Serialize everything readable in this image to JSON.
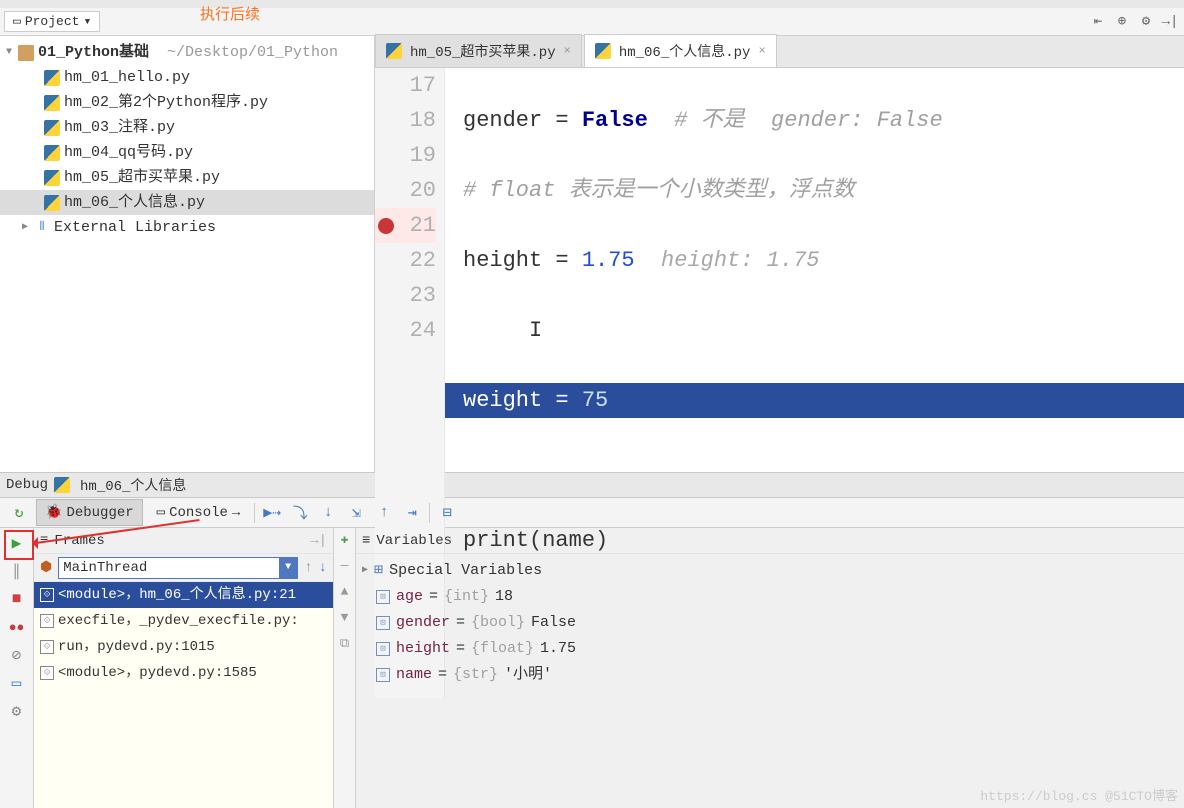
{
  "breadcrumb": {
    "a": "01_Python基础",
    "b": "hm_06_个人信息.py"
  },
  "project_dropdown": "Project",
  "tree": {
    "root": "01_Python基础",
    "root_path": "~/Desktop/01_Python",
    "files": [
      "hm_01_hello.py",
      "hm_02_第2个Python程序.py",
      "hm_03_注释.py",
      "hm_04_qq号码.py",
      "hm_05_超市买苹果.py",
      "hm_06_个人信息.py"
    ],
    "ext": "External Libraries"
  },
  "tabs": [
    {
      "label": "hm_05_超市买苹果.py"
    },
    {
      "label": "hm_06_个人信息.py"
    }
  ],
  "code": {
    "lines": [
      {
        "n": 17,
        "txt": "gender = False",
        "after": "  # 不是  gender: False"
      },
      {
        "n": 18,
        "txt": "# float 表示是一个小数类型，浮点数"
      },
      {
        "n": 19,
        "txt": "height = 1.75",
        "after": "  height: 1.75"
      },
      {
        "n": 20,
        "txt": ""
      },
      {
        "n": 21,
        "txt": "weight = 75",
        "hl": true,
        "bp": true
      },
      {
        "n": 22,
        "txt": ""
      },
      {
        "n": 23,
        "txt": "print(name)"
      },
      {
        "n": 24,
        "txt": ""
      }
    ]
  },
  "debug": {
    "title_prefix": "Debug",
    "title_file": "hm_06_个人信息",
    "tabs": {
      "debugger": "Debugger",
      "console": "Console"
    },
    "frames_label": "Frames",
    "exec_hint": "执行后续",
    "thread": "MainThread",
    "stack": [
      "<module>，hm_06_个人信息.py:21",
      "execfile，_pydev_execfile.py:",
      "run，pydevd.py:1015",
      "<module>，pydevd.py:1585"
    ],
    "vars_label": "Variables",
    "special": "Special Variables",
    "vars": [
      {
        "name": "age",
        "type": "{int}",
        "value": "18"
      },
      {
        "name": "gender",
        "type": "{bool}",
        "value": "False"
      },
      {
        "name": "height",
        "type": "{float}",
        "value": "1.75"
      },
      {
        "name": "name",
        "type": "{str}",
        "value": "'小明'"
      }
    ]
  },
  "watermark": "https://blog.cs @51CTO博客"
}
